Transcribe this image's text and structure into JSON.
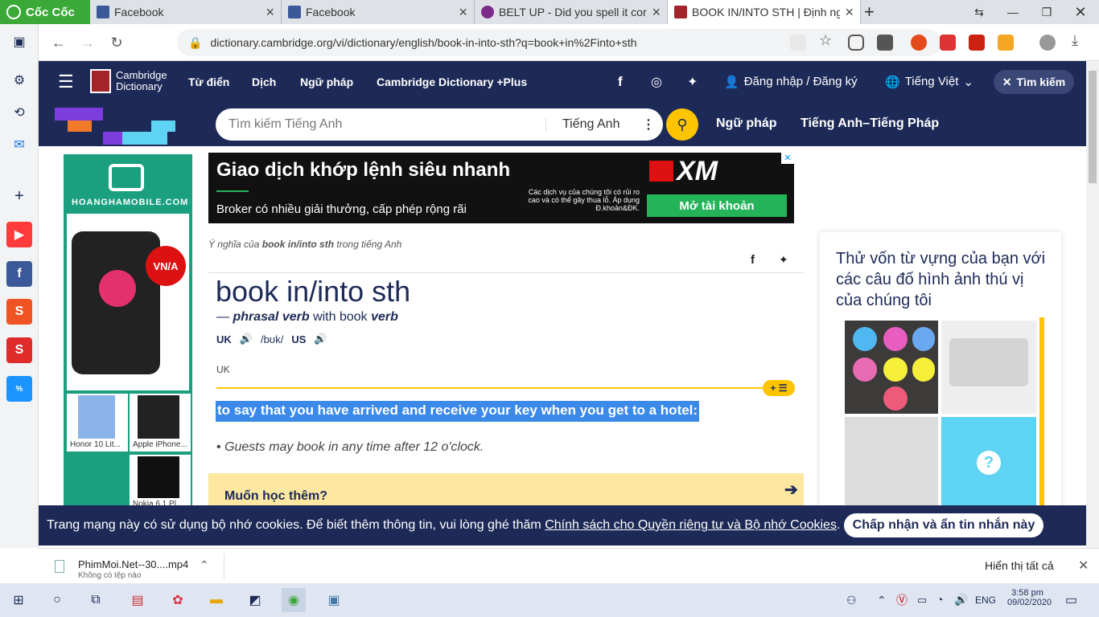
{
  "browser": {
    "brand": "Cốc Cốc",
    "tabs": [
      {
        "title": "Facebook"
      },
      {
        "title": "Facebook"
      },
      {
        "title": "BELT UP - Did you spell it corr"
      },
      {
        "title": "BOOK IN/INTO STH | Định ng"
      }
    ],
    "new_tab": "+",
    "url": "dictionary.cambridge.org/vi/dictionary/english/book-in-into-sth?q=book+in%2Finto+sth"
  },
  "site": {
    "logo_line1": "Cambridge",
    "logo_line2": "Dictionary",
    "nav": [
      "Từ điển",
      "Dịch",
      "Ngữ pháp",
      "Cambridge Dictionary +Plus"
    ],
    "login": "Đăng nhập / Đăng ký",
    "language": "Tiếng Việt",
    "search_top": "Tìm kiếm",
    "search_placeholder": "Tìm kiếm Tiếng Anh",
    "search_lang": "Tiếng Anh",
    "sub_links": [
      "Ngữ pháp",
      "Tiếng Anh–Tiếng Pháp"
    ]
  },
  "ads": {
    "left_brand": "HOANGHAMOBILE.COM",
    "left_badge": "VN/A",
    "left_products": [
      "Honor 10 Lit...",
      "Apple iPhone...",
      "Nokia 6.1 Pl..."
    ],
    "top_headline": "Giao dịch khớp lệnh siêu nhanh",
    "top_sub": "Broker có nhiều giải thưởng, cấp phép rộng rãi",
    "top_note": "Các dịch vụ của chúng tôi có rủi ro cao và có thể gây thua lỗ. Áp dụng Đ.khoản&ĐK.",
    "top_logo": "XM",
    "top_button": "Mở tài khoản"
  },
  "entry": {
    "crumb_prefix": "Ý nghĩa của",
    "crumb_word": "book in/into sth",
    "crumb_suffix": "trong tiếng Anh",
    "headword": "book in/into sth",
    "pos_dash": "—",
    "pos": "phrasal verb",
    "pos_with": "with book",
    "pos_verb": "verb",
    "uk": "UK",
    "ipa": "/bʊk/",
    "us": "US",
    "region": "UK",
    "definition": "to say that you have arrived and receive your key when you get to a hotel:",
    "example": "Guests may book in any time after 12 o'clock.",
    "more": "Muốn học thêm?"
  },
  "quiz": {
    "title": "Thử vốn từ vựng của bạn với các câu đố hình ảnh thú vị của chúng tôi",
    "question_mark": "?"
  },
  "cookie": {
    "text": "Trang mạng này có sử dụng bộ nhớ cookies. Để biết thêm thông tin, vui lòng ghé thăm",
    "link": "Chính sách cho Quyền riêng tư và Bộ nhớ Cookies",
    "period": ".",
    "button": "Chấp nhận và ẩn tin nhắn này"
  },
  "download": {
    "file": "PhimMoi.Net--30....mp4",
    "status": "Không có tệp nào",
    "show_all": "Hiển thị tất cả"
  },
  "taskbar": {
    "lang": "ENG",
    "time": "3:58 pm",
    "date": "09/02/2020"
  },
  "colors": {
    "brand_navy": "#1d2a57",
    "accent_yellow": "#fec400",
    "highlight_blue": "#3b89e8",
    "coccoc_green": "#3aa937"
  }
}
